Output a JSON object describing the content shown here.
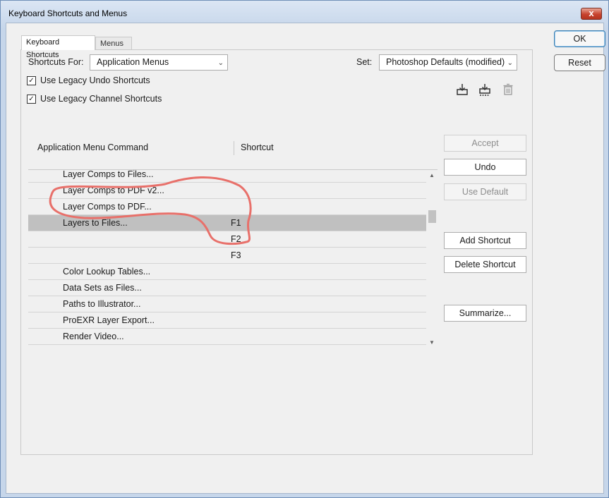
{
  "window": {
    "title": "Keyboard Shortcuts and Menus",
    "close_label": "x"
  },
  "tabs": [
    {
      "label": "Keyboard Shortcuts",
      "active": true
    },
    {
      "label": "Menus",
      "active": false
    }
  ],
  "shortcuts_for": {
    "label": "Shortcuts For:",
    "value": "Application Menus"
  },
  "set": {
    "label": "Set:",
    "value": "Photoshop Defaults (modified)"
  },
  "checkboxes": [
    {
      "label": "Use Legacy Undo Shortcuts",
      "checked": true
    },
    {
      "label": "Use Legacy Channel Shortcuts",
      "checked": true
    }
  ],
  "icons": [
    "save-set-icon",
    "new-set-icon",
    "delete-set-icon"
  ],
  "list": {
    "col_command": "Application Menu Command",
    "col_shortcut": "Shortcut",
    "rows": [
      {
        "command": "Layer Comps to Files...",
        "shortcut": ""
      },
      {
        "command": "Layer Comps to PDF v2...",
        "shortcut": ""
      },
      {
        "command": "Layer Comps to PDF...",
        "shortcut": ""
      },
      {
        "command": "Layers to Files...",
        "shortcut": "F1",
        "selected": true
      },
      {
        "command": "",
        "shortcut": "F2",
        "selected": false
      },
      {
        "command": "",
        "shortcut": "F3",
        "selected": false
      },
      {
        "command": "Color Lookup Tables...",
        "shortcut": ""
      },
      {
        "command": "Data Sets as Files...",
        "shortcut": ""
      },
      {
        "command": "Paths to Illustrator...",
        "shortcut": ""
      },
      {
        "command": "ProEXR Layer Export...",
        "shortcut": ""
      },
      {
        "command": "Render Video...",
        "shortcut": ""
      }
    ]
  },
  "actions": {
    "accept": "Accept",
    "undo": "Undo",
    "use_default": "Use Default",
    "add_shortcut": "Add Shortcut",
    "delete_shortcut": "Delete Shortcut",
    "summarize": "Summarize..."
  },
  "dialog_buttons": {
    "ok": "OK",
    "reset": "Reset"
  },
  "colors": {
    "selected_row": "#c0c0c0",
    "annotation": "#e8706a"
  }
}
